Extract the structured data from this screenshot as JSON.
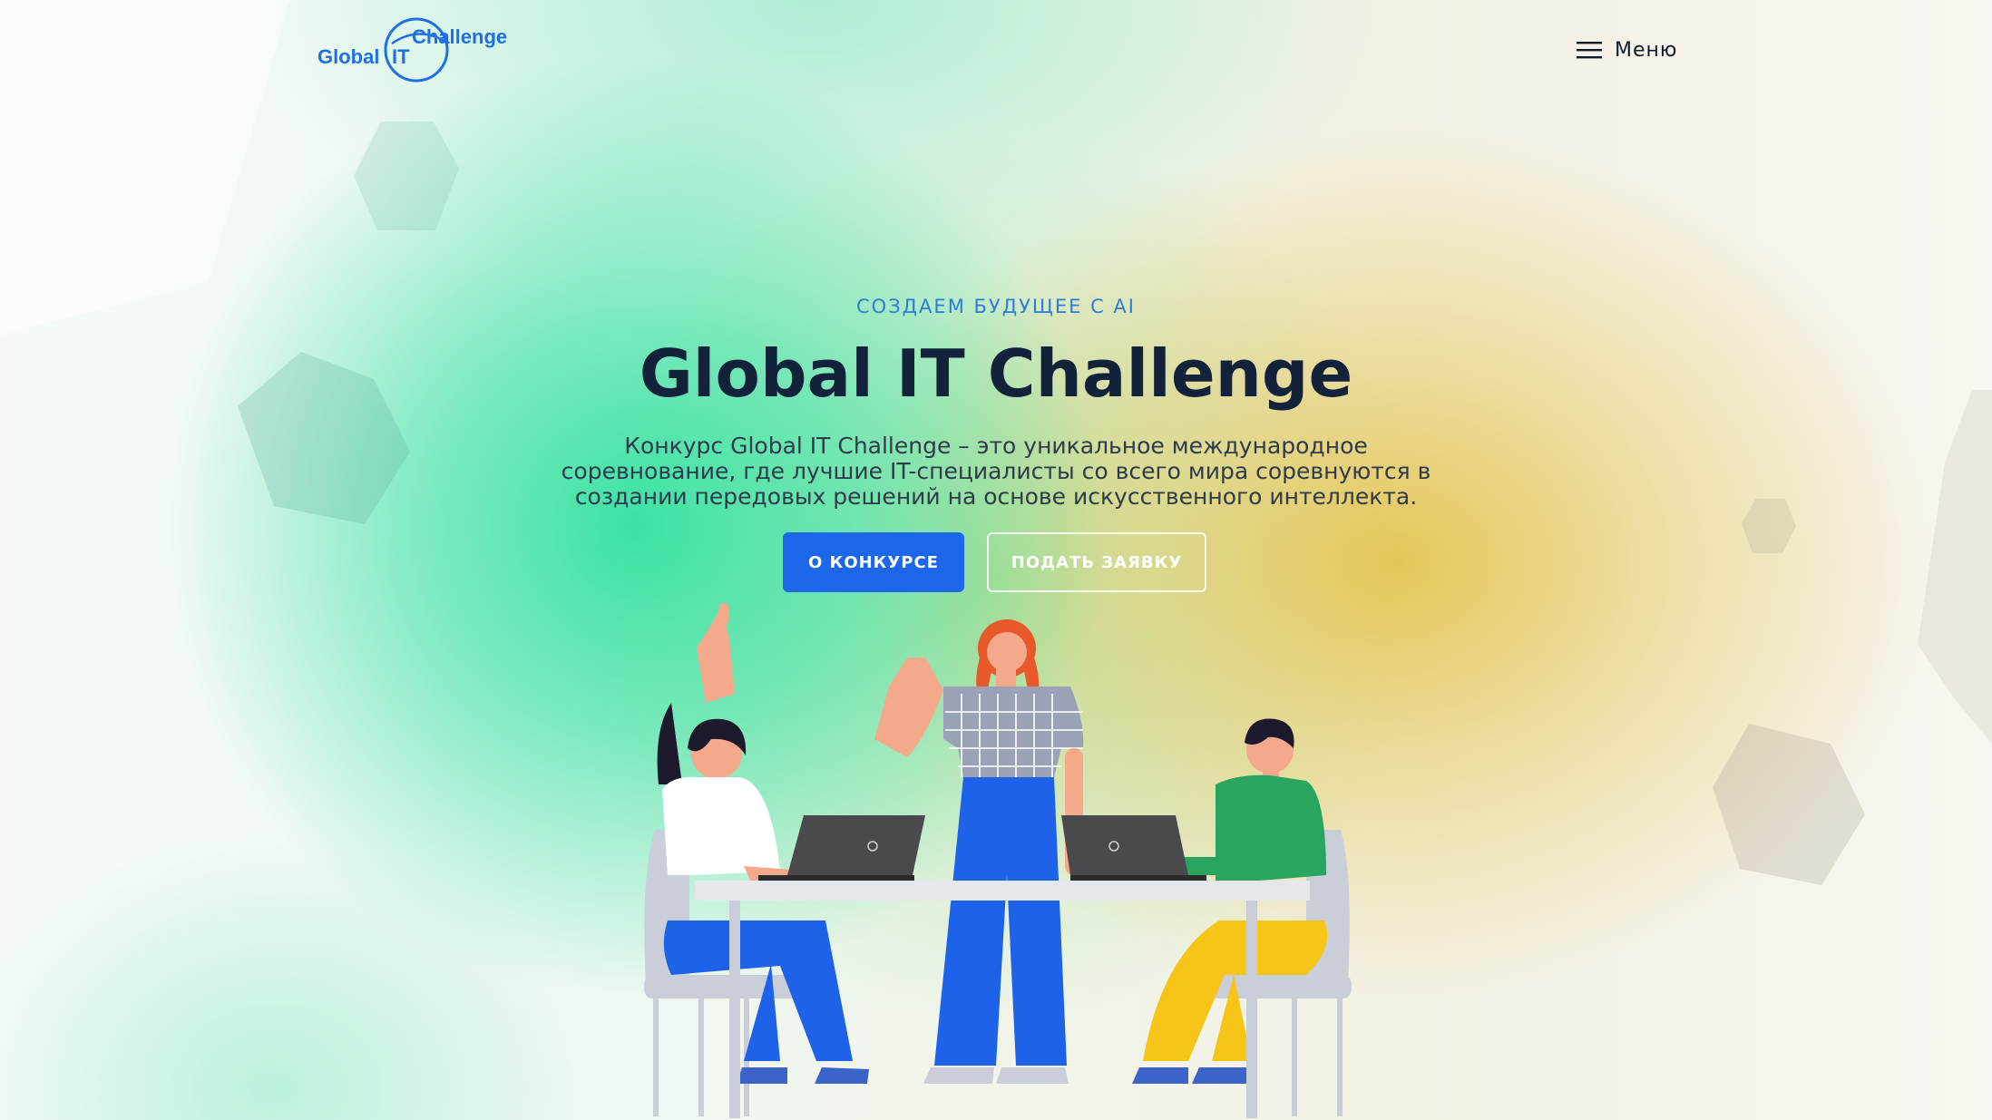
{
  "header": {
    "logo": {
      "word_global": "Global",
      "word_it": "IT",
      "word_challenge": "Challenge"
    },
    "menu": {
      "icon": "hamburger-icon",
      "label": "Меню"
    }
  },
  "hero": {
    "eyebrow": "СОЗДАЕМ БУДУЩЕЕ С AI",
    "title": "Global IT Challenge",
    "description": "Конкурс Global IT Challenge – это уникальное международное соревнование, где лучшие IT-специалисты со всего мира соревнуются в создании передовых решений на основе искусственного интеллекта.",
    "buttons": {
      "about": "О КОНКУРСЕ",
      "apply": "ПОДАТЬ ЗАЯВКУ"
    }
  },
  "colors": {
    "brand_blue": "#1c66ea",
    "title_dark": "#13223b",
    "eyebrow_blue": "#2e7cd8",
    "green_glow": "#32e1a0",
    "yellow_glow": "#e4c450"
  }
}
